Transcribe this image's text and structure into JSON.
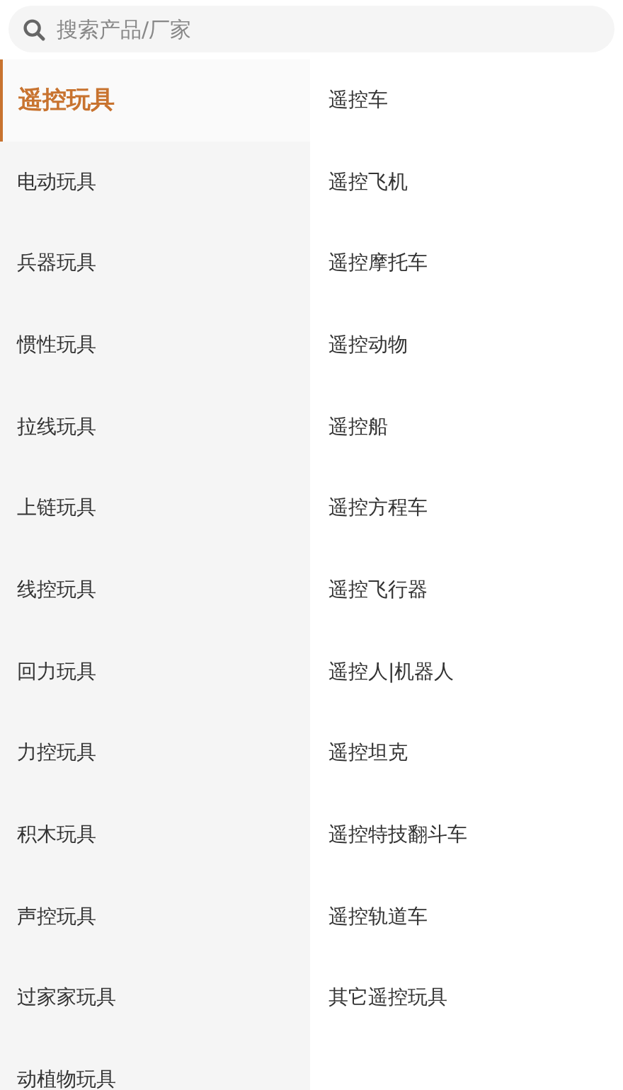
{
  "search": {
    "placeholder": "搜索产品/厂家"
  },
  "categories": [
    {
      "label": "遥控玩具",
      "selected": true
    },
    {
      "label": "电动玩具",
      "selected": false
    },
    {
      "label": "兵器玩具",
      "selected": false
    },
    {
      "label": "惯性玩具",
      "selected": false
    },
    {
      "label": "拉线玩具",
      "selected": false
    },
    {
      "label": "上链玩具",
      "selected": false
    },
    {
      "label": "线控玩具",
      "selected": false
    },
    {
      "label": "回力玩具",
      "selected": false
    },
    {
      "label": "力控玩具",
      "selected": false
    },
    {
      "label": "积木玩具",
      "selected": false
    },
    {
      "label": "声控玩具",
      "selected": false
    },
    {
      "label": "过家家玩具",
      "selected": false
    },
    {
      "label": "动植物玩具",
      "selected": false
    }
  ],
  "subcategories": [
    "遥控车",
    "遥控飞机",
    "遥控摩托车",
    "遥控动物",
    "遥控船",
    "遥控方程车",
    "遥控飞行器",
    "遥控人|机器人",
    "遥控坦克",
    "遥控特技翻斗车",
    "遥控轨道车",
    "其它遥控玩具"
  ]
}
